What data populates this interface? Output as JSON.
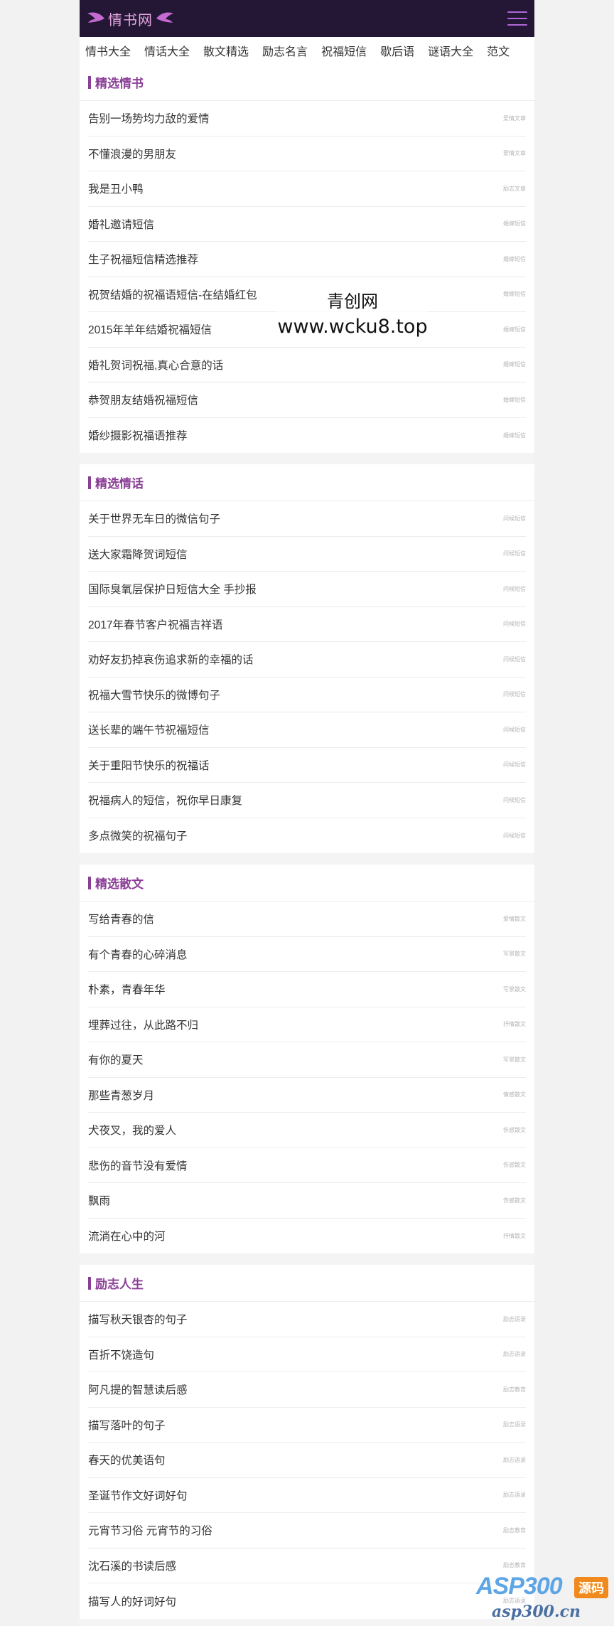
{
  "logo": {
    "text": "情书网"
  },
  "nav": [
    "情书大全",
    "情话大全",
    "散文精选",
    "励志名言",
    "祝福短信",
    "歇后语",
    "谜语大全",
    "范文"
  ],
  "sections": [
    {
      "title": "精选情书",
      "items": [
        {
          "title": "告别一场势均力敌的爱情",
          "cat": "爱情文章"
        },
        {
          "title": "不懂浪漫的男朋友",
          "cat": "爱情文章"
        },
        {
          "title": "我是丑小鸭",
          "cat": "励志文章"
        },
        {
          "title": "婚礼邀请短信",
          "cat": "婚嫁短信"
        },
        {
          "title": "生子祝福短信精选推荐",
          "cat": "婚嫁短信"
        },
        {
          "title": "祝贺结婚的祝福语短信-在结婚红包",
          "cat": "婚嫁短信"
        },
        {
          "title": "2015年羊年结婚祝福短信",
          "cat": "婚嫁短信"
        },
        {
          "title": "婚礼贺词祝福,真心合意的话",
          "cat": "婚嫁短信"
        },
        {
          "title": "恭贺朋友结婚祝福短信",
          "cat": "婚嫁短信"
        },
        {
          "title": "婚纱摄影祝福语推荐",
          "cat": "婚嫁短信"
        }
      ]
    },
    {
      "title": "精选情话",
      "items": [
        {
          "title": "关于世界无车日的微信句子",
          "cat": "问候短信"
        },
        {
          "title": "送大家霜降贺词短信",
          "cat": "问候短信"
        },
        {
          "title": "国际臭氧层保护日短信大全 手抄报",
          "cat": "问候短信"
        },
        {
          "title": "2017年春节客户祝福吉祥语",
          "cat": "问候短信"
        },
        {
          "title": "劝好友扔掉哀伤追求新的幸福的话",
          "cat": "问候短信"
        },
        {
          "title": "祝福大雪节快乐的微博句子",
          "cat": "问候短信"
        },
        {
          "title": "送长辈的端午节祝福短信",
          "cat": "问候短信"
        },
        {
          "title": "关于重阳节快乐的祝福话",
          "cat": "问候短信"
        },
        {
          "title": "祝福病人的短信，祝你早日康复",
          "cat": "问候短信"
        },
        {
          "title": "多点微笑的祝福句子",
          "cat": "问候短信"
        }
      ]
    },
    {
      "title": "精选散文",
      "items": [
        {
          "title": "写给青春的信",
          "cat": "爱情散文"
        },
        {
          "title": "有个青春的心碎消息",
          "cat": "写景散文"
        },
        {
          "title": "朴素，青春年华",
          "cat": "写景散文"
        },
        {
          "title": "埋葬过往，从此路不归",
          "cat": "抒情散文"
        },
        {
          "title": "有你的夏天",
          "cat": "写景散文"
        },
        {
          "title": "那些青葱岁月",
          "cat": "情感散文"
        },
        {
          "title": "犬夜叉，我的爱人",
          "cat": "伤感散文"
        },
        {
          "title": "悲伤的音节没有爱情",
          "cat": "伤感散文"
        },
        {
          "title": "飘雨",
          "cat": "伤感散文"
        },
        {
          "title": "流淌在心中的河",
          "cat": "抒情散文"
        }
      ]
    },
    {
      "title": "励志人生",
      "items": [
        {
          "title": "描写秋天银杏的句子",
          "cat": "励志语录"
        },
        {
          "title": "百折不饶造句",
          "cat": "励志语录"
        },
        {
          "title": "阿凡提的智慧读后感",
          "cat": "励志教育"
        },
        {
          "title": "描写落叶的句子",
          "cat": "励志语录"
        },
        {
          "title": "春天的优美语句",
          "cat": "励志语录"
        },
        {
          "title": "圣诞节作文好词好句",
          "cat": "励志语录"
        },
        {
          "title": "元宵节习俗 元宵节的习俗",
          "cat": "励志教育"
        },
        {
          "title": "沈石溪的书读后感",
          "cat": "励志教育"
        },
        {
          "title": "描写人的好词好句",
          "cat": "励志语录"
        }
      ]
    }
  ],
  "watermark": {
    "line1": "青创网",
    "line2": "www.wcku8.top"
  },
  "badge": {
    "brand": "ASP300",
    "tag": "源码",
    "url": "asp300.cn"
  }
}
